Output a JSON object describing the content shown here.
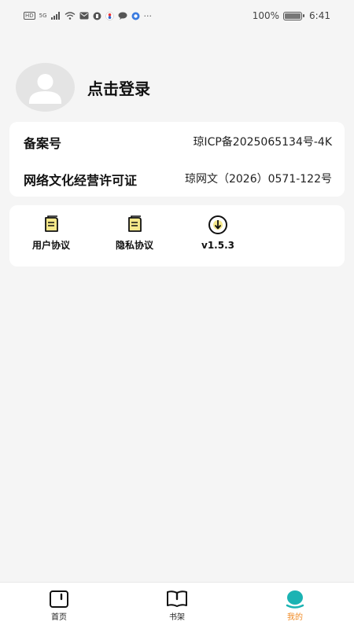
{
  "status_bar": {
    "network": "5G",
    "battery": "100%",
    "time": "6:41",
    "more": "···"
  },
  "profile": {
    "login_text": "点击登录"
  },
  "info": {
    "rows": [
      {
        "label": "备案号",
        "value": "琼ICP备2025065134号-4K"
      },
      {
        "label": "网络文化经营许可证",
        "value": "琼网文（2026）0571-122号"
      }
    ]
  },
  "actions": [
    {
      "label": "用户协议",
      "icon": "document-icon"
    },
    {
      "label": "隐私协议",
      "icon": "document-icon"
    },
    {
      "label": "v1.5.3",
      "icon": "download-circle-icon"
    }
  ],
  "bottom_nav": {
    "items": [
      {
        "label": "首页",
        "icon": "home-icon"
      },
      {
        "label": "书架",
        "icon": "book-icon"
      },
      {
        "label": "我的",
        "icon": "profile-icon",
        "active": true
      }
    ]
  },
  "colors": {
    "accent_active": "#f08a24",
    "profile_teal": "#1bb3b3",
    "doc_icon_fill": "#f5e88a"
  }
}
